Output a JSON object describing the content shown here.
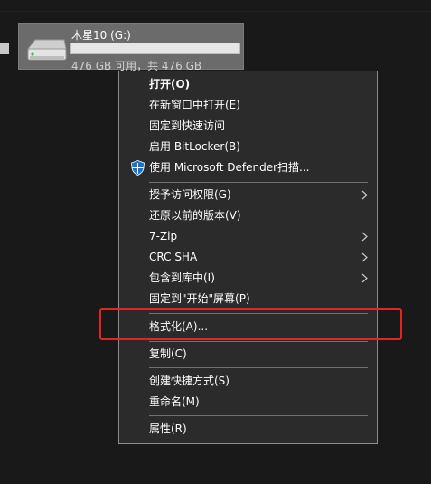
{
  "drive": {
    "name": "木星10 (G:)",
    "free_text": "476 GB 可用，共 476 GB",
    "used_fraction": 0.0
  },
  "menu": {
    "open": "打开(O)",
    "open_new_window": "在新窗口中打开(E)",
    "pin_quick_access": "固定到快速访问",
    "bitlocker": "启用 BitLocker(B)",
    "defender_scan": "使用 Microsoft Defender扫描...",
    "give_access": "授予访问权限(G)",
    "restore_previous": "还原以前的版本(V)",
    "sevenzip": "7-Zip",
    "crc_sha": "CRC SHA",
    "include_library": "包含到库中(I)",
    "pin_start": "固定到\"开始\"屏幕(P)",
    "format": "格式化(A)...",
    "copy": "复制(C)",
    "create_shortcut": "创建快捷方式(S)",
    "rename": "重命名(M)",
    "properties": "属性(R)"
  },
  "colors": {
    "menu_bg": "#2b2b2b",
    "menu_border": "#8d8d8d",
    "highlight": "#e0261e",
    "shield_blue": "#1a73c8"
  },
  "icons": {
    "drive": "hard-drive-icon",
    "defender": "windows-defender-shield-icon",
    "submenu": "chevron-right-icon"
  }
}
